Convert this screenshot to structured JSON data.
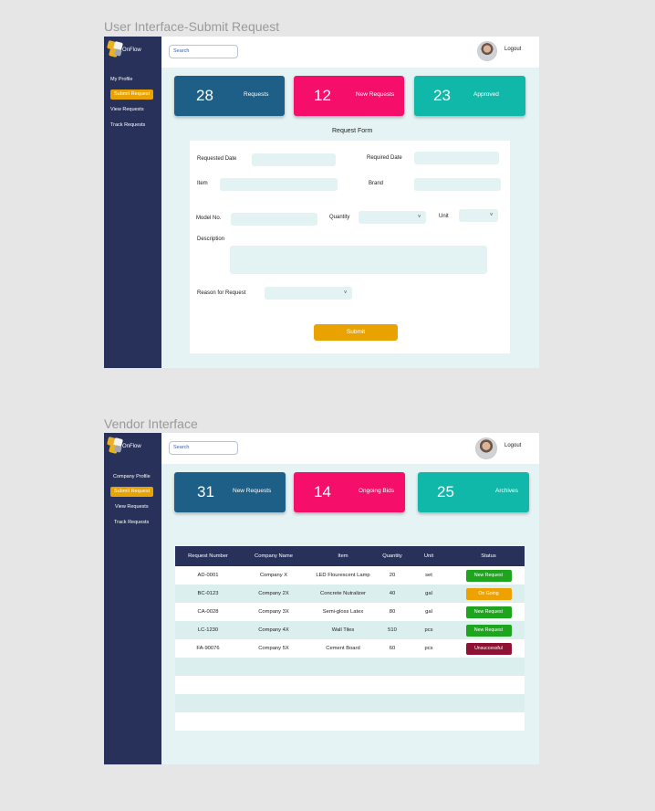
{
  "frame1": {
    "title": "User Interface-Submit Request",
    "logo_text": "OnFlow",
    "search_placeholder": "Search",
    "logout": "Logout",
    "nav": [
      "My Profile",
      "Submit Request",
      "View Requests",
      "Track Requests"
    ],
    "cards": [
      {
        "num": "28",
        "label": "Requests"
      },
      {
        "num": "12",
        "label": "New Requests"
      },
      {
        "num": "23",
        "label": "Approved"
      }
    ],
    "form": {
      "title": "Request Form",
      "requested_date": "Requested Date",
      "required_date": "Required Date",
      "item": "Item",
      "brand": "Brand",
      "model_no": "Model No.",
      "quantity": "Quantity",
      "unit": "Unit",
      "description": "Description",
      "reason": "Reason for Request",
      "chevron": "v",
      "submit": "Submit"
    }
  },
  "frame2": {
    "title": "Vendor Interface",
    "logo_text": "OnFlow",
    "search_placeholder": "Search",
    "logout": "Logout",
    "nav": [
      "Company Profile",
      "Submit Request",
      "View Requests",
      "Track Requests"
    ],
    "cards": [
      {
        "num": "31",
        "label": "New Requests"
      },
      {
        "num": "14",
        "label": "Ongoing Bids"
      },
      {
        "num": "25",
        "label": "Archives"
      }
    ],
    "table": {
      "headers": [
        "Request Number",
        "Company Name",
        "Item",
        "Quantity",
        "Unit",
        "Status"
      ],
      "rows": [
        {
          "number": "AD-0001",
          "company": "Company X",
          "item": "LED Flourescent Lamp",
          "qty": "20",
          "unit": "set",
          "status": "New Request",
          "color": "#1ea51e"
        },
        {
          "number": "BC-0123",
          "company": "Company 2X",
          "item": "Concrete Nutralizer",
          "qty": "40",
          "unit": "gal",
          "status": "On Going",
          "color": "#eda200"
        },
        {
          "number": "CA-0028",
          "company": "Company 3X",
          "item": "Semi-gloss Latex",
          "qty": "80",
          "unit": "gal",
          "status": "New Request",
          "color": "#1ea51e"
        },
        {
          "number": "LC-1230",
          "company": "Company 4X",
          "item": "Wall Tiles",
          "qty": "510",
          "unit": "pcs",
          "status": "New Request",
          "color": "#1ea51e"
        },
        {
          "number": "FA-90076",
          "company": "Company 5X",
          "item": "Cement Board",
          "qty": "60",
          "unit": "pcs",
          "status": "Unsuccessful",
          "color": "#8f1133"
        }
      ]
    }
  },
  "colors": {
    "sidebar": "#273159",
    "accent": "#e9a300",
    "card_blue": "#1d5f86",
    "card_pink": "#f50e6a",
    "card_teal": "#10b8a9"
  }
}
